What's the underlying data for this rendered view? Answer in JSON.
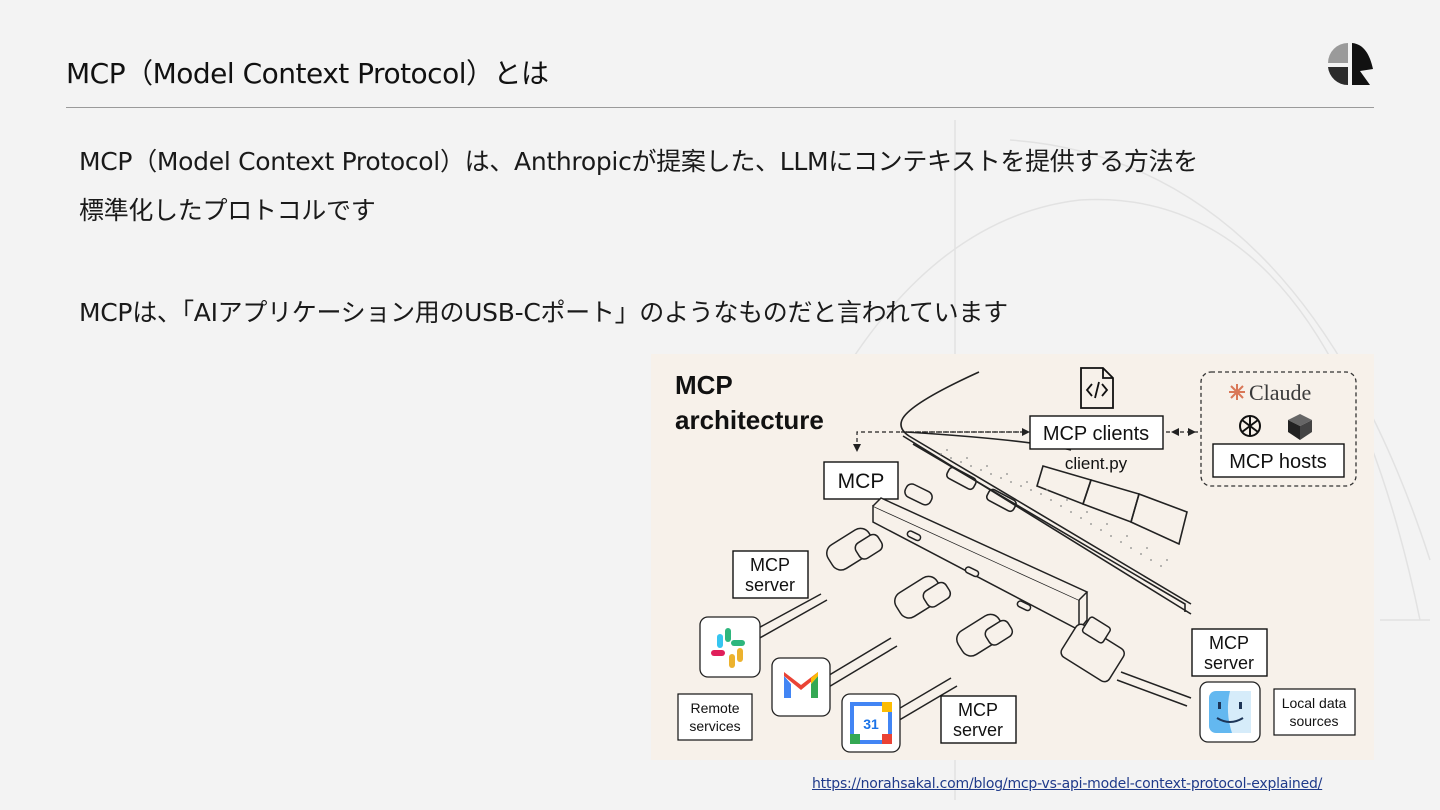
{
  "slide": {
    "title": "MCP（Model Context Protocol）とは",
    "paragraph_1_line_1": "MCP（Model Context Protocol）は、Anthropicが提案した、LLMにコンテキストを提供する方法を",
    "paragraph_1_line_2": "標準化したプロトコルです",
    "paragraph_2": "MCPは、「AIアプリケーション用のUSB-Cポート」のようなものだと言われています",
    "source_link": "https://norahsakal.com/blog/mcp-vs-api-model-context-protocol-explained/"
  },
  "figure": {
    "heading_line_1": "MCP",
    "heading_line_2": "architecture",
    "clients_label": "MCP clients",
    "clients_file": "client.py",
    "hosts_label": "MCP hosts",
    "claude_label": "Claude",
    "hub_label": "MCP",
    "server_label_1_line_1": "MCP",
    "server_label_1_line_2": "server",
    "server_label_2_line_1": "MCP",
    "server_label_2_line_2": "server",
    "server_label_3_line_1": "MCP",
    "server_label_3_line_2": "server",
    "remote_line_1": "Remote",
    "remote_line_2": "services",
    "local_line_1": "Local data",
    "local_line_2": "sources",
    "calendar_number": "31",
    "icons": [
      "file-code-icon",
      "claude-logo-icon",
      "openai-logo-icon",
      "cube-logo-icon",
      "slack-icon",
      "gmail-icon",
      "google-calendar-icon",
      "finder-icon"
    ]
  },
  "colors": {
    "background": "#f3f3f3",
    "figure_background": "#f7f1ea",
    "claude_orange": "#d97757",
    "link_blue": "#1f3a8a"
  }
}
